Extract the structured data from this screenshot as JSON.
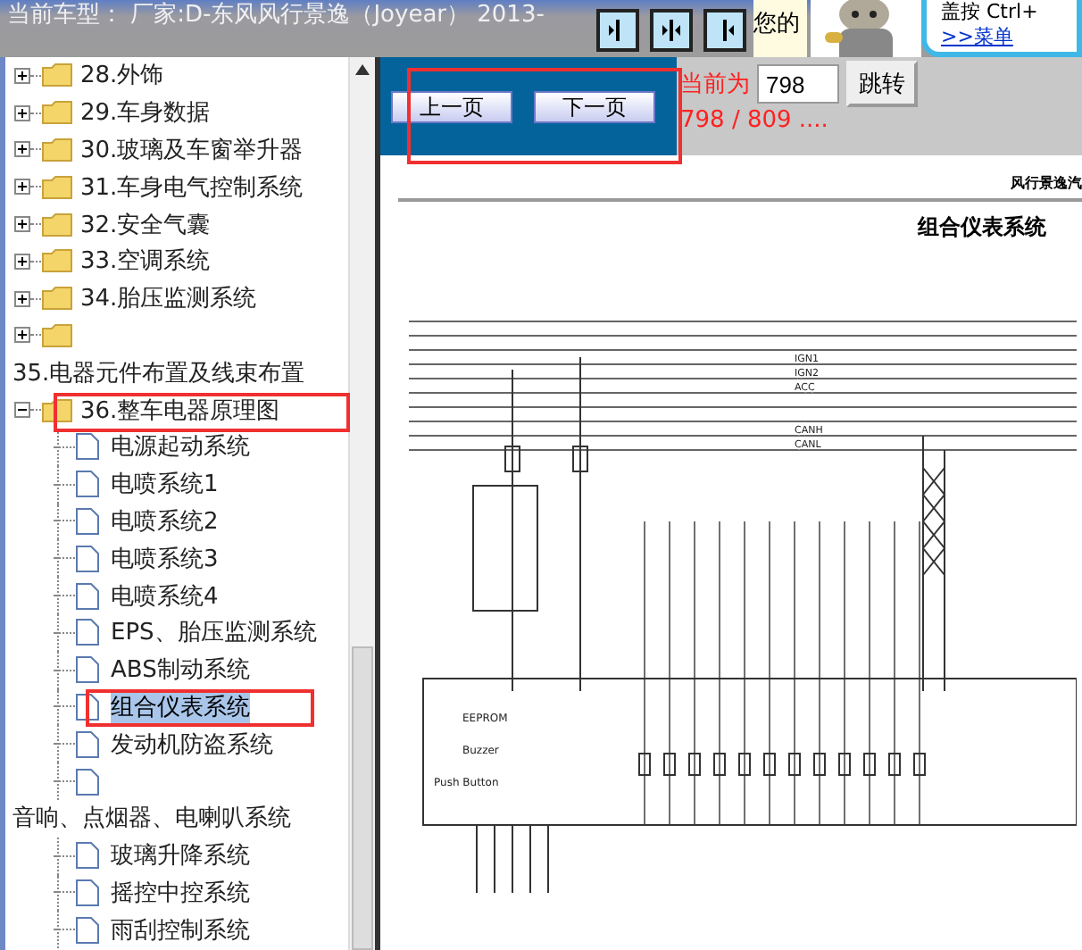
{
  "header": {
    "model_text": "当前车型： 厂家:D-东风风行景逸（Joyear） 2013-",
    "user_text": "您的",
    "tip_line1": "盖按 Ctrl+",
    "tip_link": ">>菜单"
  },
  "nav_buttons": [
    {
      "kind": "right"
    },
    {
      "kind": "both"
    },
    {
      "kind": "left"
    }
  ],
  "tree": [
    {
      "kind": "folder",
      "label": "28.外饰",
      "expanded": false
    },
    {
      "kind": "folder",
      "label": "29.车身数据",
      "expanded": false
    },
    {
      "kind": "folder",
      "label": "30.玻璃及车窗举升器",
      "expanded": false
    },
    {
      "kind": "folder",
      "label": "31.车身电气控制系统",
      "expanded": false
    },
    {
      "kind": "folder",
      "label": "32.安全气囊",
      "expanded": false
    },
    {
      "kind": "folder",
      "label": "33.空调系统",
      "expanded": false
    },
    {
      "kind": "folder",
      "label": "34.胎压监测系统",
      "expanded": false
    },
    {
      "kind": "folder",
      "expanded": false
    },
    {
      "kind": "text",
      "label": "35.电器元件布置及线束布置"
    },
    {
      "kind": "folder",
      "label": "36.整车电器原理图",
      "expanded": true,
      "children": [
        {
          "kind": "doc",
          "label": "电源起动系统",
          "selected": false
        },
        {
          "kind": "doc",
          "label": "电喷系统1",
          "selected": false
        },
        {
          "kind": "doc",
          "label": "电喷系统2",
          "selected": false
        },
        {
          "kind": "doc",
          "label": "电喷系统3",
          "selected": false
        },
        {
          "kind": "doc",
          "label": "电喷系统4",
          "selected": false
        },
        {
          "kind": "doc",
          "label": "EPS、胎压监测系统",
          "selected": false
        },
        {
          "kind": "doc",
          "label": "ABS制动系统",
          "selected": false
        },
        {
          "kind": "doc",
          "label": "组合仪表系统",
          "selected": true
        },
        {
          "kind": "doc",
          "label": "发动机防盗系统",
          "selected": false
        },
        {
          "kind": "doc"
        },
        {
          "kind": "text",
          "label": "音响、点烟器、电喇叭系统",
          "selected": false
        },
        {
          "kind": "doc",
          "label": "玻璃升降系统",
          "selected": false
        },
        {
          "kind": "doc",
          "label": "摇控中控系统",
          "selected": false
        },
        {
          "kind": "doc",
          "label": "雨刮控制系统",
          "selected": false
        }
      ]
    }
  ],
  "pager": {
    "prev": "上一页",
    "next": "下一页",
    "current_label": "当前为",
    "page_value": "798",
    "go": "跳转",
    "count": "798 / 809 ...."
  },
  "diagram": {
    "header": "风行景逸汽",
    "title": "组合仪表系统",
    "bus_labels": [
      "IGN1",
      "IGN2",
      "ACC",
      "CANH",
      "CANL"
    ],
    "box_labels": [
      "EEPROM",
      "Buzzer",
      "Push Button"
    ]
  }
}
